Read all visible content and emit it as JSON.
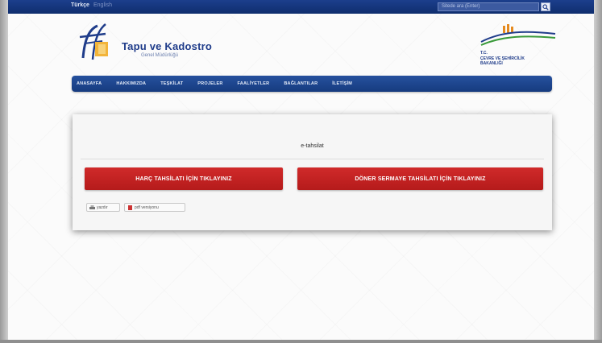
{
  "topbar": {
    "lang_tr": "Türkçe",
    "lang_en": "English",
    "search_placeholder": "Sitede ara (Enter)",
    "search_icon": "search-icon"
  },
  "header": {
    "title": "Tapu ve Kadostro",
    "subtitle": "Genel Müdürlüğü",
    "ministry_line1": "T.C.",
    "ministry_line2": "ÇEVRE VE ŞEHİRCİLİK",
    "ministry_line3": "BAKANLIĞI"
  },
  "nav": {
    "items": [
      "ANASAYFA",
      "HAKKIMIZDA",
      "TEŞKİLAT",
      "PROJELER",
      "FAALİYETLER",
      "BAĞLANTILAR",
      "İLETİŞİM"
    ]
  },
  "panel": {
    "title": "e-tahsilat",
    "harc_button": "HARÇ TAHSİLATI İÇİN TIKLAYINIZ",
    "doner_button": "DÖNER SERMAYE TAHSİLATI İÇİN TIKLAYINIZ",
    "print_label": "yazdır",
    "pdf_label": "pdf versiyonu"
  },
  "colors": {
    "topbar": "#0f2e6e",
    "nav": "#1f4790",
    "accent_red": "#c22222",
    "brand_blue": "#1f3c8a"
  }
}
